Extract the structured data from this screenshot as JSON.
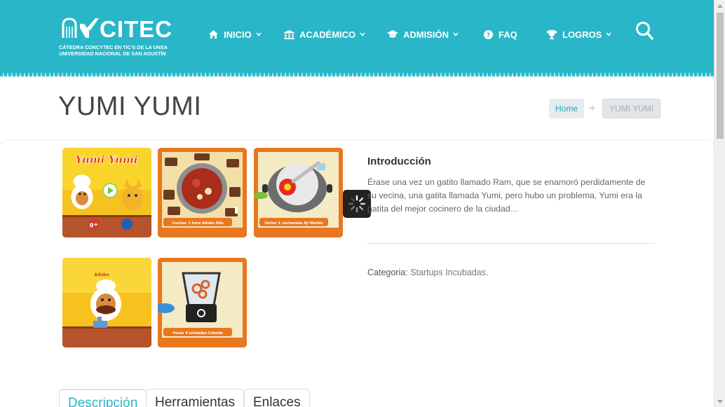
{
  "brand": {
    "name": "CITEC",
    "subtitle_line1": "CÁTEDRA CONCYTEC EN TIC'S DE LA UNSA",
    "subtitle_line2": "UNIVERSIDAD NACIONAL DE SAN AGUSTÍN"
  },
  "nav": {
    "items": [
      {
        "label": "INICIO",
        "icon": "home-icon",
        "has_dropdown": true
      },
      {
        "label": "ACADÉMICO",
        "icon": "institution-icon",
        "has_dropdown": true
      },
      {
        "label": "ADMISIÓN",
        "icon": "graduation-cap-icon",
        "has_dropdown": true
      },
      {
        "label": "FAQ",
        "icon": "question-circle-icon",
        "has_dropdown": false
      },
      {
        "label": "LOGROS",
        "icon": "trophy-icon",
        "has_dropdown": true
      }
    ],
    "search_icon": "search-icon"
  },
  "page": {
    "title": "YUMI YUMI"
  },
  "breadcrumb": {
    "home": "Home",
    "current": "YUMI YUMI"
  },
  "gallery": {
    "thumbnails": [
      {
        "caption_title": "Yumi Yumi"
      },
      {
        "caption": "Cocinar 1 hora Adobo Olla"
      },
      {
        "caption": "Verter 1 cucharada Ají Molido"
      },
      {
        "caption": "Adobo"
      },
      {
        "caption": "Poner 4 unidades Cebolla"
      }
    ]
  },
  "intro": {
    "heading": "Introducción",
    "text": "Érase una vez un gatito llamado Ram, que se enamoró perdidamente de su vecina, una gatita llamada Yumi, pero hubo un problema, Yumi era la gatita del mejor cocinero de la ciudad…"
  },
  "meta": {
    "category_label": "Categoria:",
    "category_value": "Startups Incubadas."
  },
  "tabs": [
    {
      "label": "Descripción",
      "active": true
    },
    {
      "label": "Herramientas",
      "active": false
    },
    {
      "label": "Enlaces",
      "active": false
    }
  ],
  "colors": {
    "header": "#29b6c8",
    "accent": "#29b6c8",
    "breadcrumb_home_text": "#2aa6b4"
  }
}
